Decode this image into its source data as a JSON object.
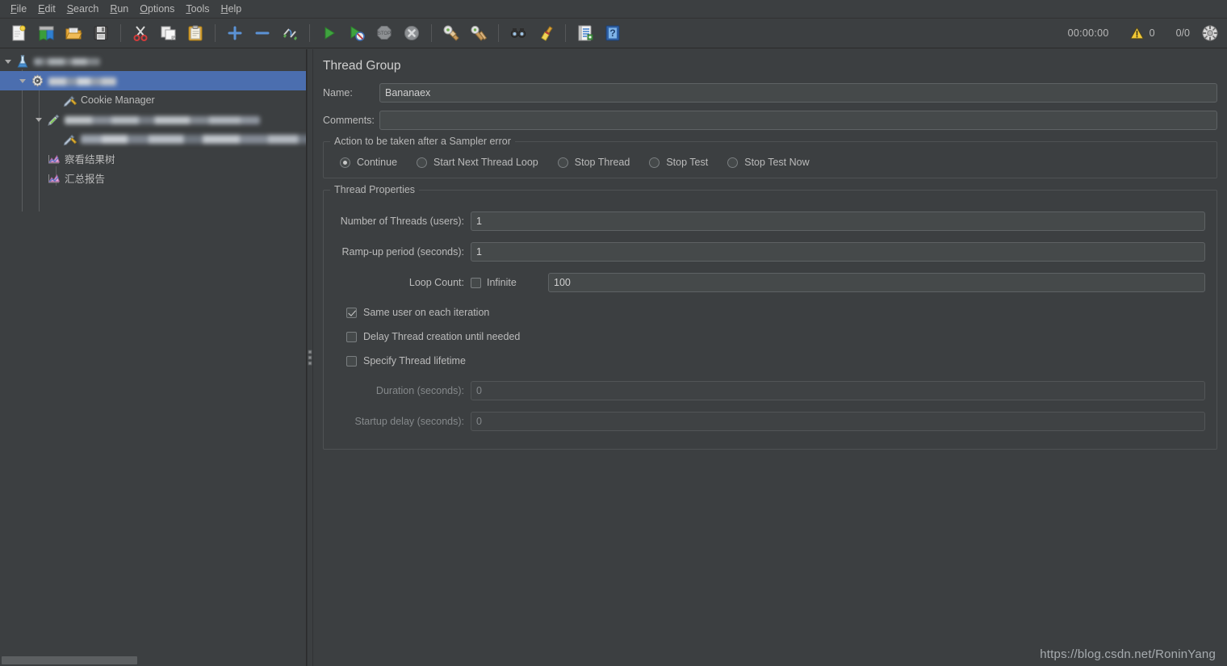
{
  "menubar": {
    "items": [
      {
        "name": "file",
        "pre": "F",
        "post": "ile"
      },
      {
        "name": "edit",
        "pre": "E",
        "post": "dit"
      },
      {
        "name": "search",
        "pre": "S",
        "post": "earch"
      },
      {
        "name": "run",
        "pre": "R",
        "post": "un"
      },
      {
        "name": "options",
        "pre": "O",
        "post": "ptions"
      },
      {
        "name": "tools",
        "pre": "T",
        "post": "ools"
      },
      {
        "name": "help",
        "pre": "H",
        "post": "elp"
      }
    ]
  },
  "toolbar": {
    "buttons": [
      {
        "name": "new-icon",
        "title": "New"
      },
      {
        "name": "templates-icon",
        "title": "Templates"
      },
      {
        "name": "open-icon",
        "title": "Open"
      },
      {
        "name": "save-icon",
        "title": "Save Test Plan"
      },
      {
        "name": "cut-icon",
        "title": "Cut"
      },
      {
        "name": "copy-icon",
        "title": "Copy"
      },
      {
        "name": "paste-icon",
        "title": "Paste"
      },
      {
        "name": "expand-all-icon",
        "title": "Expand All"
      },
      {
        "name": "collapse-all-icon",
        "title": "Collapse All"
      },
      {
        "name": "toggle-icon",
        "title": "Toggle"
      },
      {
        "name": "start-icon",
        "title": "Start"
      },
      {
        "name": "start-no-pauses-icon",
        "title": "Start no pauses"
      },
      {
        "name": "stop-icon",
        "title": "Stop"
      },
      {
        "name": "shutdown-icon",
        "title": "Shutdown"
      },
      {
        "name": "clear-icon",
        "title": "Clear"
      },
      {
        "name": "clear-all-icon",
        "title": "Clear All"
      },
      {
        "name": "search-icon",
        "title": "Search"
      },
      {
        "name": "reset-search-icon",
        "title": "Reset Search"
      },
      {
        "name": "function-helper-icon",
        "title": "Function Helper Dialog"
      },
      {
        "name": "help-icon",
        "title": "Help"
      }
    ],
    "timer": "00:00:00",
    "warning_count": "0",
    "thread_count": "0/0",
    "remote_icon": "remote-engines-icon"
  },
  "tree": {
    "nodes": [
      {
        "name": "test-plan",
        "icon": "test-plan-icon",
        "label": "",
        "blur": "b1",
        "depth": 0,
        "twisty": true,
        "selected": false
      },
      {
        "name": "thread-group",
        "icon": "thread-group-icon",
        "label": "",
        "blur": "b2",
        "depth": 1,
        "twisty": true,
        "selected": true
      },
      {
        "name": "cookie-manager",
        "icon": "config-element-icon",
        "label": "Cookie Manager",
        "blur": "",
        "depth": 2,
        "twisty": false,
        "selected": false
      },
      {
        "name": "http-sampler",
        "icon": "sampler-icon",
        "label": "",
        "blur": "b3",
        "depth": 2,
        "twisty": true,
        "selected": false
      },
      {
        "name": "http-sub-config",
        "icon": "config-element-icon",
        "label": "",
        "blur": "b4",
        "depth": 3,
        "twisty": false,
        "selected": false
      },
      {
        "name": "view-results-tree",
        "icon": "listener-icon",
        "label": "察看结果树",
        "blur": "",
        "depth": 2,
        "twisty": false,
        "selected": false
      },
      {
        "name": "summary-report",
        "icon": "listener-icon",
        "label": "汇总报告",
        "blur": "",
        "depth": 2,
        "twisty": false,
        "selected": false
      }
    ]
  },
  "panel": {
    "title": "Thread Group",
    "name_label": "Name:",
    "name_value": "Bananaex",
    "comments_label": "Comments:",
    "comments_value": "",
    "error_action": {
      "legend": "Action to be taken after a Sampler error",
      "options": [
        {
          "name": "continue",
          "label": "Continue",
          "selected": true
        },
        {
          "name": "start-next-loop",
          "label": "Start Next Thread Loop",
          "selected": false
        },
        {
          "name": "stop-thread",
          "label": "Stop Thread",
          "selected": false
        },
        {
          "name": "stop-test",
          "label": "Stop Test",
          "selected": false
        },
        {
          "name": "stop-test-now",
          "label": "Stop Test Now",
          "selected": false
        }
      ]
    },
    "thread_properties": {
      "legend": "Thread Properties",
      "num_threads_label": "Number of Threads (users):",
      "num_threads_value": "1",
      "rampup_label": "Ramp-up period (seconds):",
      "rampup_value": "1",
      "loop_count_label": "Loop Count:",
      "infinite_label": "Infinite",
      "infinite_checked": false,
      "loop_count_value": "100",
      "same_user_label": "Same user on each iteration",
      "same_user_checked": true,
      "delay_thread_label": "Delay Thread creation until needed",
      "delay_thread_checked": false,
      "specify_lifetime_label": "Specify Thread lifetime",
      "specify_lifetime_checked": false,
      "duration_label": "Duration (seconds):",
      "duration_value": "0",
      "duration_disabled": true,
      "startup_delay_label": "Startup delay (seconds):",
      "startup_delay_value": "0",
      "startup_delay_disabled": true
    }
  },
  "watermark": "https://blog.csdn.net/RoninYang",
  "colors": {
    "background": "#3c3f41",
    "selection": "#4b6eaf",
    "text": "#bbbbbb",
    "field_bg": "#45494a",
    "border": "#5e6264",
    "accent_green": "#4c9e4c",
    "accent_yellow": "#e8c13d"
  }
}
